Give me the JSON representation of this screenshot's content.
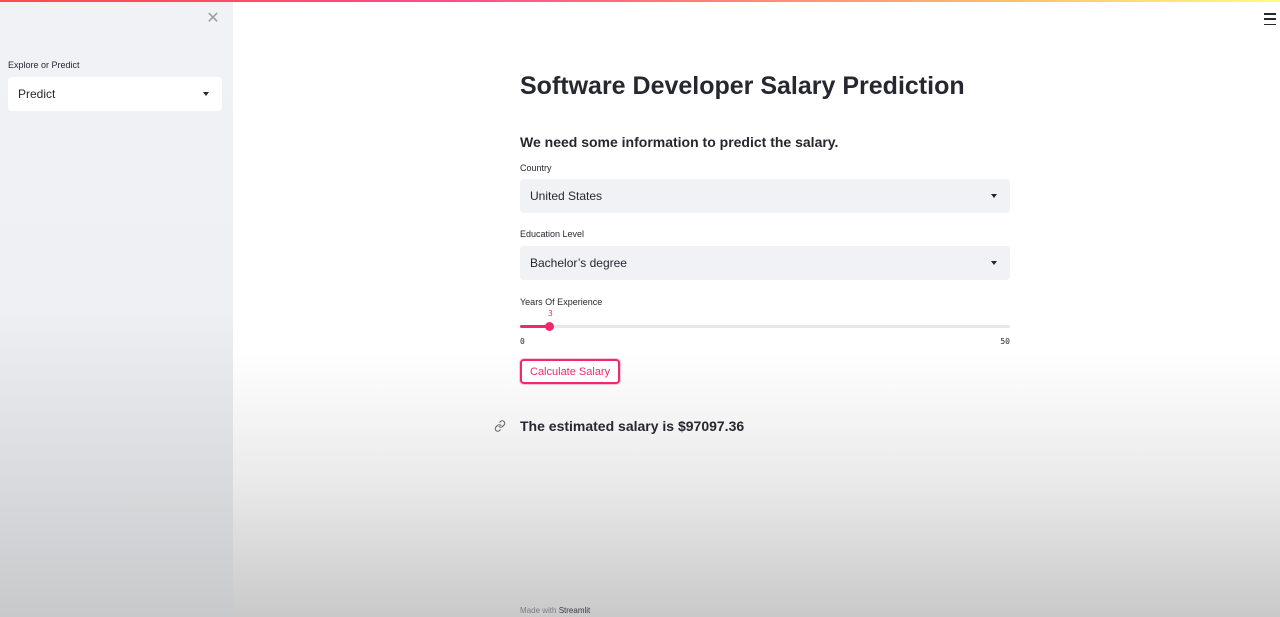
{
  "sidebar": {
    "section_label": "Explore or Predict",
    "selected_option": "Predict"
  },
  "main": {
    "title": "Software Developer Salary Prediction",
    "subheader": "We need some information to predict the salary.",
    "country": {
      "label": "Country",
      "selected": "United States"
    },
    "education": {
      "label": "Education Level",
      "selected": "Bachelor’s degree"
    },
    "experience": {
      "label": "Years Of Experience",
      "value": 3,
      "min": 0,
      "max": 50
    },
    "calculate_label": "Calculate Salary",
    "result": "The estimated salary is $97097.36"
  },
  "footer": {
    "prefix": "Made with",
    "brand": "Streamlit"
  },
  "colors": {
    "accent": "#f0296f",
    "sidebar_bg": "#f0f2f6",
    "text": "#262730"
  }
}
